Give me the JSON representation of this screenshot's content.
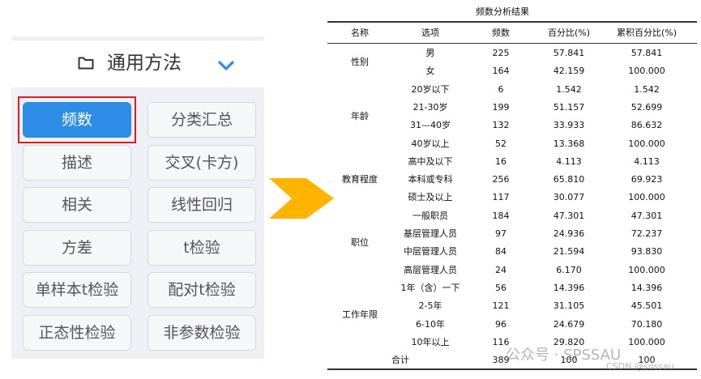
{
  "panel": {
    "title": "通用方法",
    "buttons": [
      "频数",
      "分类汇总",
      "描述",
      "交叉(卡方)",
      "相关",
      "线性回归",
      "方差",
      "t检验",
      "单样本t检验",
      "配对t检验",
      "正态性检验",
      "非参数检验"
    ],
    "active_index": 0,
    "accent_color": "#2c8ce6",
    "highlight_color": "#e21c1c"
  },
  "table": {
    "title": "频数分析结果",
    "headers": [
      "名称",
      "选项",
      "频数",
      "百分比(%)",
      "累积百分比(%)"
    ],
    "groups": [
      {
        "name": "性别",
        "rows": [
          [
            "男",
            "225",
            "57.841",
            "57.841"
          ],
          [
            "女",
            "164",
            "42.159",
            "100.000"
          ]
        ]
      },
      {
        "name": "年龄",
        "rows": [
          [
            "20岁以下",
            "6",
            "1.542",
            "1.542"
          ],
          [
            "21-30岁",
            "199",
            "51.157",
            "52.699"
          ],
          [
            "31—40岁",
            "132",
            "33.933",
            "86.632"
          ],
          [
            "40岁以上",
            "52",
            "13.368",
            "100.000"
          ]
        ]
      },
      {
        "name": "教育程度",
        "rows": [
          [
            "高中及以下",
            "16",
            "4.113",
            "4.113"
          ],
          [
            "本科或专科",
            "256",
            "65.810",
            "69.923"
          ],
          [
            "硕士及以上",
            "117",
            "30.077",
            "100.000"
          ]
        ]
      },
      {
        "name": "职位",
        "rows": [
          [
            "一般职员",
            "184",
            "47.301",
            "47.301"
          ],
          [
            "基层管理人员",
            "97",
            "24.936",
            "72.237"
          ],
          [
            "中层管理人员",
            "84",
            "21.594",
            "93.830"
          ],
          [
            "高层管理人员",
            "24",
            "6.170",
            "100.000"
          ]
        ]
      },
      {
        "name": "工作年限",
        "rows": [
          [
            "1年（含）一下",
            "56",
            "14.396",
            "14.396"
          ],
          [
            "2-5年",
            "121",
            "31.105",
            "45.501"
          ],
          [
            "6-10年",
            "96",
            "24.679",
            "70.180"
          ],
          [
            "10年以上",
            "116",
            "29.820",
            "100.000"
          ]
        ]
      }
    ],
    "total": {
      "label": "合计",
      "freq": "389",
      "pct": "100",
      "cum": "100"
    }
  },
  "watermark": {
    "line1": "公众号 · SPSSAU",
    "line2": "CSDN @spssau"
  },
  "arrow_color": "#ffb400"
}
